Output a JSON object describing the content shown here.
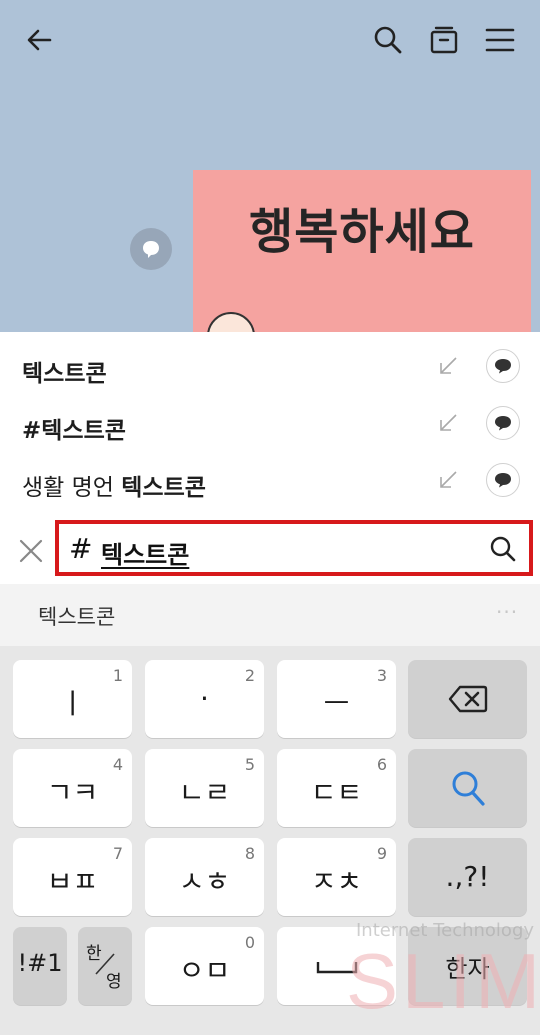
{
  "chat": {
    "emoticon_text": "행복하세요"
  },
  "results": [
    {
      "prefix": "",
      "bold": "텍스트콘"
    },
    {
      "prefix": "",
      "bold": "#텍스트콘"
    },
    {
      "prefix": "생활 명언",
      "bold": "텍스트콘"
    }
  ],
  "search": {
    "hash": "#",
    "query": "텍스트콘"
  },
  "suggestion": {
    "word": "텍스트콘",
    "more": "···"
  },
  "keyboard": {
    "row1": [
      {
        "main": "ㅣ",
        "num": "1"
      },
      {
        "main": "·",
        "num": "2"
      },
      {
        "main": "ㅡ",
        "num": "3"
      }
    ],
    "row2": [
      {
        "main": "ㄱㅋ",
        "num": "4"
      },
      {
        "main": "ㄴㄹ",
        "num": "5"
      },
      {
        "main": "ㄷㅌ",
        "num": "6"
      }
    ],
    "row3": [
      {
        "main": "ㅂㅍ",
        "num": "7"
      },
      {
        "main": "ㅅㅎ",
        "num": "8"
      },
      {
        "main": "ㅈㅊ",
        "num": "9"
      }
    ],
    "punct": ".,?!",
    "symbols": "!#1",
    "lang_top": "한",
    "lang_bottom": "영",
    "om": "ㅇㅁ",
    "om_num": "0",
    "space": "",
    "hanja": "한자"
  },
  "watermark": {
    "line1": "Internet Technology",
    "line2": "SLIM"
  },
  "colors": {
    "chat_bg": "#aec2d7",
    "emoticon_bg": "#f5a3a0",
    "highlight_border": "#d7191b",
    "search_accent": "#2f7fd8"
  }
}
